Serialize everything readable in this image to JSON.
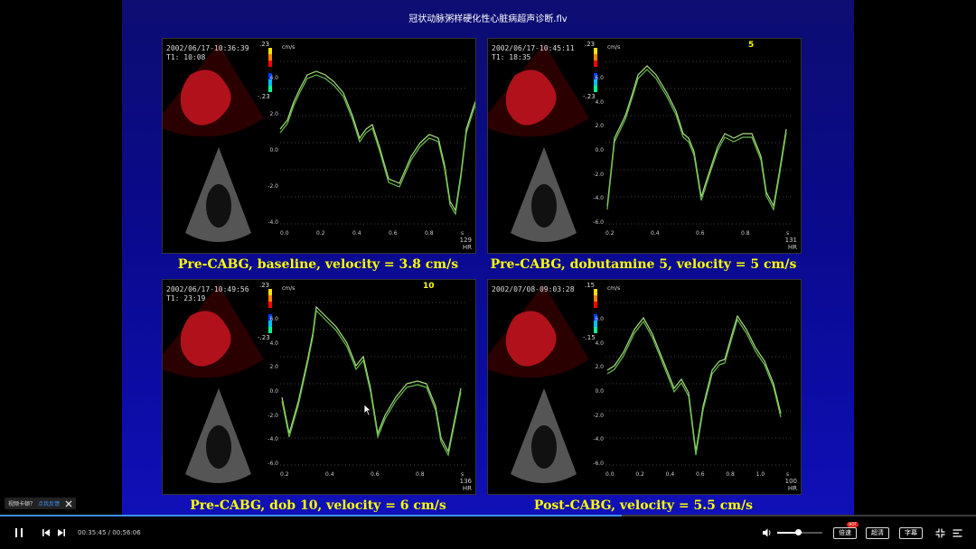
{
  "video": {
    "title": "冠状动脉粥样硬化性心脏病超声诊断.flv"
  },
  "panels": [
    {
      "timestamp": "2002/06/17-10:36:39",
      "t1": "T1: 10:08",
      "stage_label": "",
      "scale_top": ".23",
      "scale_bottom": "-.23",
      "unit": "cm/s",
      "hr": "129",
      "hr_unit": "HR",
      "y_ticks": [
        "4.0",
        "2.0",
        "0.0",
        "-2.0",
        "-4.0"
      ],
      "x_ticks": [
        "0.0",
        "0.2",
        "0.4",
        "0.6",
        "0.8",
        "s"
      ],
      "caption": "Pre-CABG, baseline, velocity = 3.8 cm/s"
    },
    {
      "timestamp": "2002/06/17-10:45:11",
      "t1": "T1: 18:35",
      "stage_label": "5",
      "scale_top": ".23",
      "scale_bottom": "-.23",
      "unit": "cm/s",
      "hr": "131",
      "hr_unit": "HR",
      "y_ticks": [
        "6.0",
        "4.0",
        "2.0",
        "0.0",
        "-2.0",
        "-4.0",
        "-6.0"
      ],
      "x_ticks": [
        "0.2",
        "0.4",
        "0.6",
        "0.8",
        "s"
      ],
      "caption": "Pre-CABG, dobutamine 5, velocity = 5 cm/s"
    },
    {
      "timestamp": "2002/06/17-10:49:56",
      "t1": "T1: 23:19",
      "stage_label": "10",
      "scale_top": ".23",
      "scale_bottom": "-.23",
      "unit": "cm/s",
      "hr": "136",
      "hr_unit": "HR",
      "y_ticks": [
        "6.0",
        "4.0",
        "2.0",
        "0.0",
        "-2.0",
        "-4.0",
        "-6.0"
      ],
      "x_ticks": [
        "0.2",
        "0.4",
        "0.6",
        "0.8",
        "s"
      ],
      "caption": "Pre-CABG, dob 10, velocity = 6 cm/s"
    },
    {
      "timestamp": "2002/07/08-09:03:28",
      "t1": "",
      "stage_label": "",
      "scale_top": ".15",
      "scale_bottom": "-.15",
      "unit": "cm/s",
      "hr": "100",
      "hr_unit": "HR",
      "y_ticks": [
        "6.0",
        "4.0",
        "2.0",
        "0.0",
        "-2.0",
        "-4.0",
        "-6.0"
      ],
      "x_ticks": [
        "0.0",
        "0.2",
        "0.4",
        "0.6",
        "0.8",
        "1.0",
        "s"
      ],
      "caption": "Post-CABG, velocity = 5.5 cm/s"
    }
  ],
  "player": {
    "current_time": "00:35:45",
    "separator": " / ",
    "duration": "00:56:06",
    "progress_fraction": 0.637,
    "volume_fraction": 0.45,
    "speed_label": "倍速",
    "speed_badge": "HOT",
    "quality_label": "超清",
    "subtitle_label": "字幕",
    "toast_text": "视频卡顿？",
    "toast_link": "点我反馈",
    "accent": "#3e8ef7"
  },
  "icons": {
    "play_pause": "pause-icon",
    "prev": "previous-icon",
    "next": "next-icon",
    "volume": "volume-icon",
    "fullscreen": "fullscreen-exit-icon",
    "playlist": "playlist-icon",
    "close": "close-icon"
  }
}
